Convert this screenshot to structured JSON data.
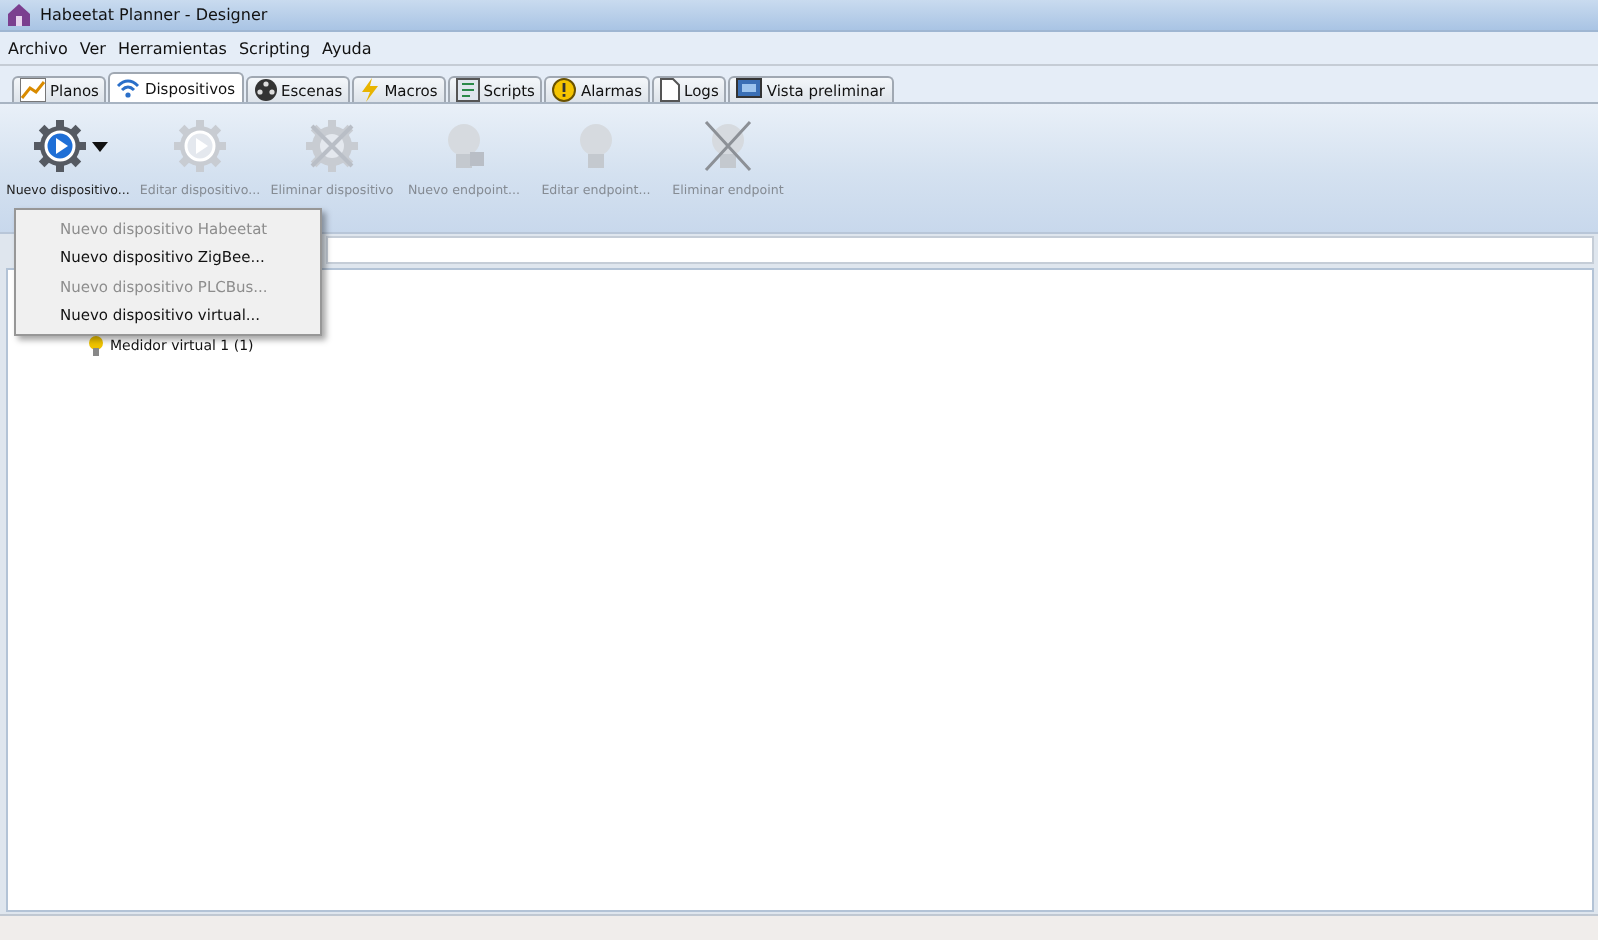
{
  "window": {
    "title": "Habeetat Planner - Designer"
  },
  "menu": [
    "Archivo",
    "Ver",
    "Herramientas",
    "Scripting",
    "Ayuda"
  ],
  "tabs": [
    {
      "label": "Planos",
      "kind": "chart",
      "selected": false
    },
    {
      "label": "Dispositivos",
      "kind": "wifi",
      "selected": true
    },
    {
      "label": "Escenas",
      "kind": "film",
      "selected": false
    },
    {
      "label": "Macros",
      "kind": "bolt",
      "selected": false
    },
    {
      "label": "Scripts",
      "kind": "script",
      "selected": false
    },
    {
      "label": "Alarmas",
      "kind": "alarm",
      "selected": false
    },
    {
      "label": "Logs",
      "kind": "page",
      "selected": false
    },
    {
      "label": "Vista preliminar",
      "kind": "preview",
      "selected": false
    }
  ],
  "toolbar": [
    {
      "label": "Nuevo dispositivo...",
      "kind": "gear",
      "disabled": false,
      "dropdown": true
    },
    {
      "label": "Editar dispositivo...",
      "kind": "gear",
      "disabled": true,
      "dropdown": false
    },
    {
      "label": "Eliminar dispositivo",
      "kind": "gear-x",
      "disabled": true,
      "dropdown": false
    },
    {
      "label": "Nuevo endpoint...",
      "kind": "bulb-plus",
      "disabled": true,
      "dropdown": false
    },
    {
      "label": "Editar endpoint...",
      "kind": "bulb",
      "disabled": true,
      "dropdown": false
    },
    {
      "label": "Eliminar endpoint",
      "kind": "bulb-x",
      "disabled": true,
      "dropdown": false
    }
  ],
  "dropdown_menu": [
    {
      "label": "Nuevo dispositivo Habeetat",
      "disabled": true
    },
    {
      "label": "Nuevo dispositivo ZigBee...",
      "disabled": false
    },
    {
      "label": "Nuevo dispositivo PLCBus...",
      "disabled": true
    },
    {
      "label": "Nuevo dispositivo virtual...",
      "disabled": false
    }
  ],
  "tree": [
    {
      "label": "Medidor virtual 1 (1)"
    }
  ]
}
